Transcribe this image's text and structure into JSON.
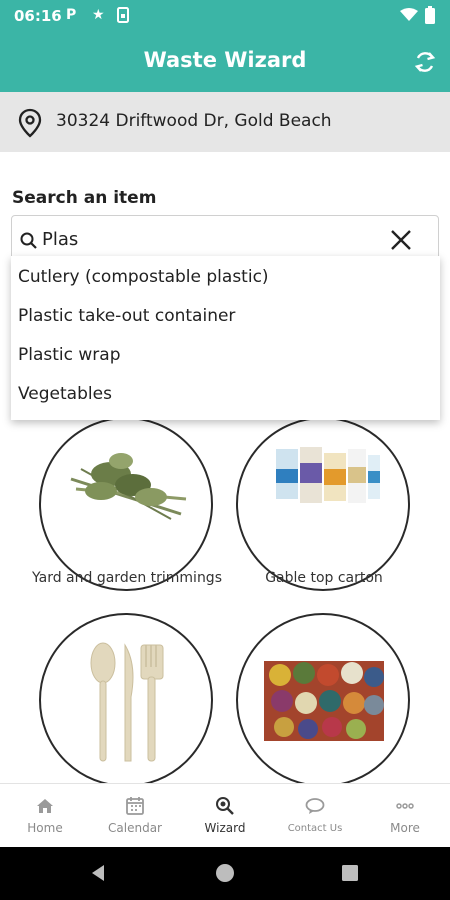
{
  "status_bar": {
    "time": "06:16",
    "left_icons": [
      "parking-icon",
      "star-icon",
      "sim-icon"
    ],
    "right_icons": [
      "wifi-icon",
      "battery-icon"
    ]
  },
  "app_bar": {
    "title": "Waste Wizard",
    "refresh_icon": "refresh-icon"
  },
  "address": {
    "icon": "location-pin-icon",
    "text": "30324 Driftwood Dr, Gold Beach"
  },
  "search": {
    "label": "Search an item",
    "value": "Plas",
    "clear_icon": "close-icon"
  },
  "suggestions": [
    "Cutlery (compostable plastic)",
    "Plastic take-out container",
    "Plastic wrap",
    "Vegetables"
  ],
  "tiles": [
    {
      "label": "Yard and garden trimmings"
    },
    {
      "label": "Gable top carton"
    },
    {
      "label": ""
    },
    {
      "label": ""
    }
  ],
  "bottom_nav": [
    {
      "label": "Home",
      "icon": "home-icon",
      "active": false
    },
    {
      "label": "Calendar",
      "icon": "calendar-icon",
      "active": false
    },
    {
      "label": "Wizard",
      "icon": "wizard-search-icon",
      "active": true
    },
    {
      "label": "Contact Us",
      "icon": "chat-icon",
      "active": false
    },
    {
      "label": "More",
      "icon": "more-icon",
      "active": false
    }
  ],
  "colors": {
    "accent": "#3bb5a6",
    "address_bg": "#e6e6e6"
  }
}
